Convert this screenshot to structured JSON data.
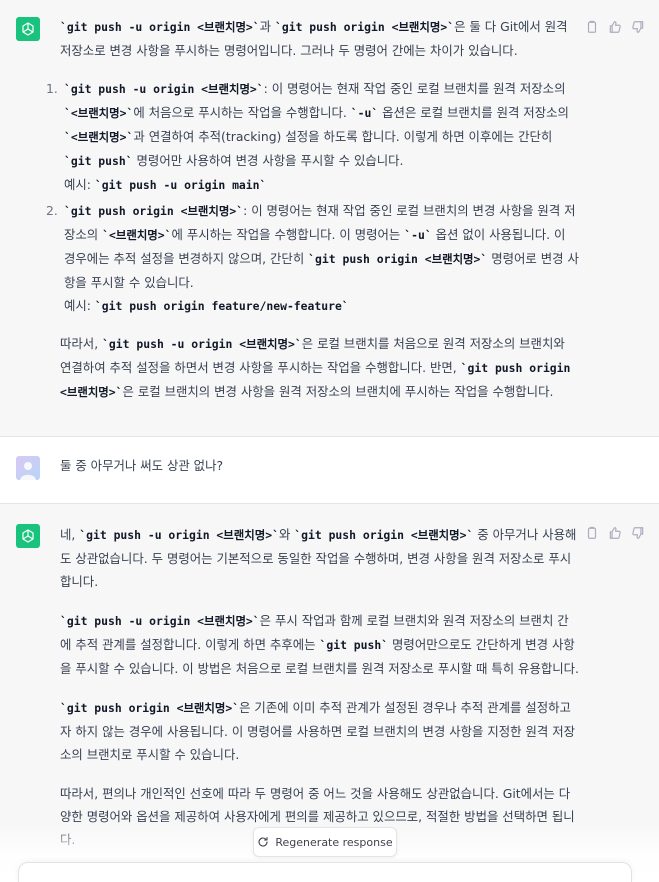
{
  "msg1": {
    "intro_a": "`git push -u origin <브랜치명>`",
    "intro_b": "과 ",
    "intro_c": "`git push origin <브랜치명>`",
    "intro_d": "은 둘 다 Git에서 원격 저장소로 변경 사항을 푸시하는 명령어입니다. 그러나 두 명령어 간에는 차이가 있습니다.",
    "items": [
      {
        "num": "1.",
        "code1": "`git push -u origin <브랜치명>`",
        "t1": ": 이 명령어는 현재 작업 중인 로컬 브랜치를 원격 저장소의 ",
        "code2": "`<브랜치명>`",
        "t2": "에 처음으로 푸시하는 작업을 수행합니다. ",
        "code3": "`-u`",
        "t3": " 옵션은 로컬 브랜치를 원격 저장소의 ",
        "code4": "`<브랜치명>`",
        "t4": "과 연결하여 추적(tracking) 설정을 하도록 합니다. 이렇게 하면 이후에는 간단히 ",
        "code5": "`git push`",
        "t5": " 명령어만 사용하여 변경 사항을 푸시할 수 있습니다.",
        "example_label": "예시: ",
        "example_code": "`git push -u origin main`"
      },
      {
        "num": "2.",
        "code1": "`git push origin <브랜치명>`",
        "t1": ": 이 명령어는 현재 작업 중인 로컬 브랜치의 변경 사항을 원격 저장소의 ",
        "code2": "`<브랜치명>`",
        "t2": "에 푸시하는 작업을 수행합니다. 이 명령어는 ",
        "code3": "`-u`",
        "t3": " 옵션 없이 사용됩니다. 이 경우에는 추적 설정을 변경하지 않으며, 간단히 ",
        "code4": "`git push origin <브랜치명>`",
        "t4": " 명령어로 변경 사항을 푸시할 수 있습니다.",
        "example_label": "예시: ",
        "example_code": "`git push origin feature/new-feature`"
      }
    ],
    "outro_a": "따라서, ",
    "outro_b": "`git push -u origin <브랜치명>`",
    "outro_c": "은 로컬 브랜치를 처음으로 원격 저장소의 브랜치와 연결하여 추적 설정을 하면서 변경 사항을 푸시하는 작업을 수행합니다. 반면, ",
    "outro_d": "`git push origin <브랜치명>`",
    "outro_e": "은 로컬 브랜치의 변경 사항을 원격 저장소의 브랜치에 푸시하는 작업을 수행합니다."
  },
  "user": {
    "text": "둘 중 아무거나 써도 상관 없나?"
  },
  "msg2": {
    "p1_a": "네, ",
    "p1_b": "`git push -u origin <브랜치명>`",
    "p1_c": "와 ",
    "p1_d": "`git push origin <브랜치명>`",
    "p1_e": " 중 아무거나 사용해도 상관없습니다. 두 명령어는 기본적으로 동일한 작업을 수행하며, 변경 사항을 원격 저장소로 푸시합니다.",
    "p2_a": "`git push -u origin <브랜치명>`",
    "p2_b": "은 푸시 작업과 함께 로컬 브랜치와 원격 저장소의 브랜치 간에 추적 관계를 설정합니다. 이렇게 하면 추후에는 ",
    "p2_c": "`git push`",
    "p2_d": " 명령어만으로도 간단하게 변경 사항을 푸시할 수 있습니다. 이 방법은 처음으로 로컬 브랜치를 원격 저장소로 푸시할 때 특히 유용합니다.",
    "p3_a": "`git push origin <브랜치명>`",
    "p3_b": "은 기존에 이미 추적 관계가 설정된 경우나 추적 관계를 설정하고자 하지 않는 경우에 사용됩니다. 이 명령어를 사용하면 로컬 브랜치의 변경 사항을 지정한 원격 저장소의 브랜치로 푸시할 수 있습니다.",
    "p4": "따라서, 편의나 개인적인 선호에 따라 두 명령어 중 어느 것을 사용해도 상관없습니다. Git에서는 다양한 명령어와 옵션을 제공하여 사용자에게 편의를 제공하고 있으므로, 적절한 방법을 선택하면 됩니다."
  },
  "regenerate_label": "Regenerate response",
  "icons": {
    "assistant_avatar": "openai-logo-icon",
    "user_avatar": "user-avatar-icon",
    "copy": "clipboard-icon",
    "like": "thumbs-up-icon",
    "dislike": "thumbs-down-icon",
    "regen": "refresh-icon"
  },
  "colors": {
    "assistant_bg": "#f7f7f8",
    "brand_green": "#19c37d",
    "text": "#374151"
  }
}
